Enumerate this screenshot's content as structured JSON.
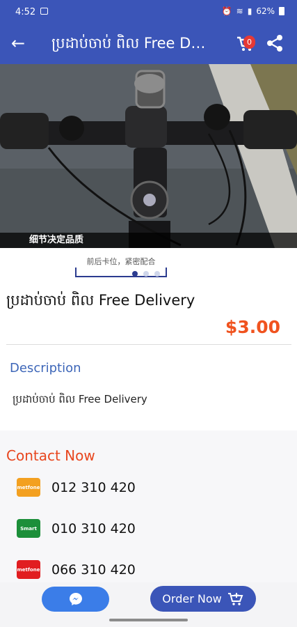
{
  "status_bar": {
    "time": "4:52",
    "battery": "62%"
  },
  "app_bar": {
    "title": "ប្រដាប់ចាប់ ពិល Free Delivery",
    "cart_count": "0"
  },
  "gallery": {
    "caption": "细节决定品质",
    "thumb_caption": "前后卡位，紧密配合",
    "current_index": 1,
    "total": 3
  },
  "product": {
    "title": "ប្រដាប់ចាប់ ពិល Free Delivery",
    "price": "$3.00"
  },
  "description": {
    "heading": "Description",
    "text": "ប្រដាប់ចាប់ ពិល Free Delivery"
  },
  "contact": {
    "heading": "Contact Now",
    "numbers": [
      {
        "operator_logo": "metfone",
        "color": "#f3a020",
        "number": "012 310 420"
      },
      {
        "operator_logo": "Smart",
        "color": "#1c8f3a",
        "number": "010 310 420"
      },
      {
        "operator_logo": "metfone",
        "color": "#e11d20",
        "number": "066 310 420"
      }
    ]
  },
  "actions": {
    "order_label": "Order Now"
  },
  "colors": {
    "primary": "#3b55b8",
    "accent": "#f0531f",
    "messenger": "#3b7de8"
  }
}
